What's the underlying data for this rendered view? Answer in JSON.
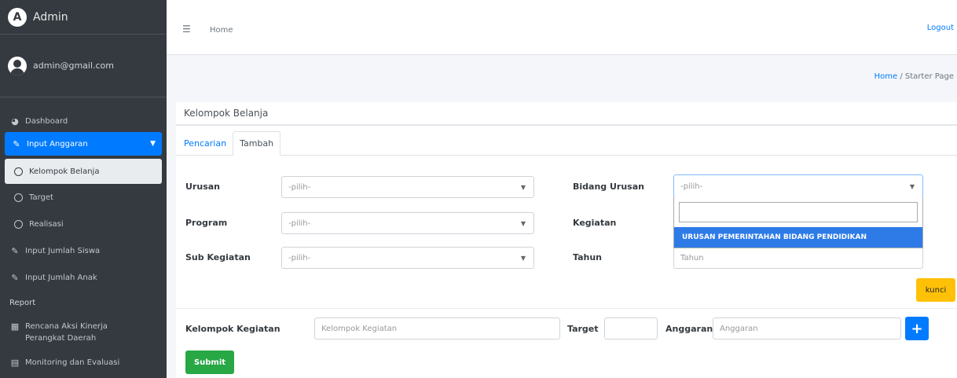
{
  "brand": {
    "text": "Admin"
  },
  "user": {
    "email": "admin@gmail.com"
  },
  "sidebar": {
    "dashboard": "Dashboard",
    "input_anggaran": "Input Anggaran",
    "sub_items": [
      "Kelompok Belanja",
      "Target",
      "Realisasi"
    ],
    "input_siswa": "Input Jumlah Siswa",
    "input_anak": "Input Jumlah Anak",
    "report_header": "Report",
    "rencana_aksi": "Rencana Aksi Kinerja Perangkat Daerah",
    "monev": "Monitoring dan Evaluasi"
  },
  "topbar": {
    "home": "Home",
    "logout": "Logout"
  },
  "breadcrumb": {
    "home": "Home",
    "separator": "/",
    "current": "Starter Page"
  },
  "card": {
    "title": "Kelompok Belanja"
  },
  "tabs": [
    "Pencarian",
    "Tambah"
  ],
  "form": {
    "urusan_label": "Urusan",
    "urusan_value": "-pilih-",
    "program_label": "Program",
    "program_value": "-pilih-",
    "sub_kegiatan_label": "Sub Kegiatan",
    "sub_kegiatan_value": "-pilih-",
    "bidang_label": "Bidang Urusan",
    "bidang_value": "-pilih-",
    "kegiatan_label": "Kegiatan",
    "tahun_label": "Tahun",
    "tahun_placeholder": "Tahun",
    "dropdown_option": "URUSAN PEMERINTAHAN BIDANG PENDIDIKAN",
    "kunci_button": "kunci",
    "kelompok_label": "Kelompok Kegiatan",
    "kelompok_placeholder": "Kelompok Kegiatan",
    "target_label": "Target",
    "anggaran_label": "Anggaran",
    "anggaran_placeholder": "Anggaran",
    "add_button": "+",
    "submit_button": "Submit"
  }
}
